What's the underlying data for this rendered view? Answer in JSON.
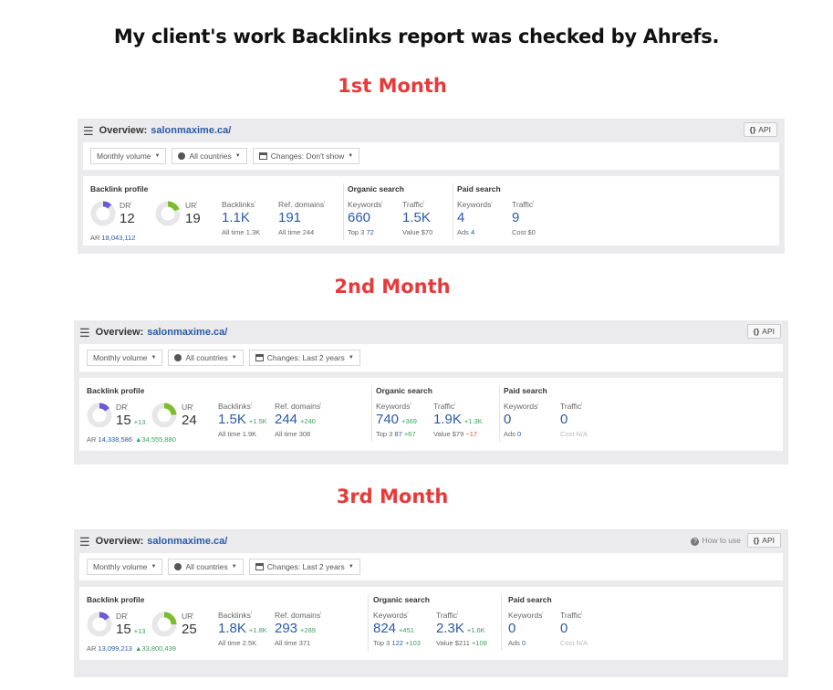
{
  "title": "My client's work Backlinks report was checked by Ahrefs.",
  "colors": {
    "month_title": "#e83a3a",
    "link_blue": "#2a5ba8",
    "positive": "#3aa35a",
    "negative": "#d9543b",
    "dr_color": "#6b5bd2",
    "ur_color": "#7cbd2e"
  },
  "labels": {
    "overview": "Overview:",
    "api": "API",
    "how_to_use": "How to use",
    "backlink_profile": "Backlink profile",
    "organic_search": "Organic search",
    "paid_search": "Paid search",
    "dr": "DR",
    "ur": "UR",
    "backlinks": "Backlinks",
    "ref_domains": "Ref. domains",
    "keywords": "Keywords",
    "traffic": "Traffic",
    "ar": "AR",
    "all_time": "All time",
    "top3": "Top 3",
    "value": "Value",
    "ads": "Ads",
    "cost": "Cost",
    "info": "i"
  },
  "icons": {
    "menu": "hamburger-menu-icon",
    "globe": "globe-icon",
    "calendar": "calendar-icon",
    "caret": "caret-down-icon",
    "api": "code-braces-icon",
    "help": "question-circle-icon"
  },
  "reports": [
    {
      "month": "1st Month",
      "domain": "salonmaxime.ca/",
      "show_how_to_use": false,
      "filters": {
        "volume": "Monthly volume",
        "countries": "All countries",
        "changes": "Changes: Don't show"
      },
      "dr": {
        "value": "12",
        "delta": "",
        "fraction": 0.12
      },
      "ur": {
        "value": "19",
        "delta": "",
        "fraction": 0.19
      },
      "ar": {
        "value": "18,043,112",
        "delta": ""
      },
      "backlinks": {
        "value": "1.1K",
        "delta": "",
        "all_time": "1.3K"
      },
      "ref_domains": {
        "value": "191",
        "delta": "",
        "all_time": "244"
      },
      "organic_keywords": {
        "value": "660",
        "delta": "",
        "top3": "72",
        "top3_delta": ""
      },
      "organic_traffic": {
        "value": "1.5K",
        "delta": "",
        "value_usd": "$70",
        "value_delta": ""
      },
      "paid_keywords": {
        "value": "4",
        "ads": "4"
      },
      "paid_traffic": {
        "value": "9",
        "cost": "$0"
      }
    },
    {
      "month": "2nd Month",
      "domain": "salonmaxime.ca/",
      "show_how_to_use": false,
      "filters": {
        "volume": "Monthly volume",
        "countries": "All countries",
        "changes": "Changes: Last 2 years"
      },
      "dr": {
        "value": "15",
        "delta": "+13",
        "fraction": 0.15
      },
      "ur": {
        "value": "24",
        "delta": "",
        "fraction": 0.24
      },
      "ar": {
        "value": "14,338,586",
        "delta": "▲34,555,880"
      },
      "backlinks": {
        "value": "1.5K",
        "delta": "+1.5K",
        "all_time": "1.9K"
      },
      "ref_domains": {
        "value": "244",
        "delta": "+240",
        "all_time": "308"
      },
      "organic_keywords": {
        "value": "740",
        "delta": "+369",
        "top3": "87",
        "top3_delta": "+67"
      },
      "organic_traffic": {
        "value": "1.9K",
        "delta": "+1.3K",
        "value_usd": "$79",
        "value_delta": "−17"
      },
      "paid_keywords": {
        "value": "0",
        "ads": "0"
      },
      "paid_traffic": {
        "value": "0",
        "cost": "N/A"
      }
    },
    {
      "month": "3rd Month",
      "domain": "salonmaxime.ca/",
      "show_how_to_use": true,
      "filters": {
        "volume": "Monthly volume",
        "countries": "All countries",
        "changes": "Changes: Last 2 years"
      },
      "dr": {
        "value": "15",
        "delta": "+13",
        "fraction": 0.15
      },
      "ur": {
        "value": "25",
        "delta": "",
        "fraction": 0.25
      },
      "ar": {
        "value": "13,099,213",
        "delta": "▲33,800,439"
      },
      "backlinks": {
        "value": "1.8K",
        "delta": "+1.8K",
        "all_time": "2.5K"
      },
      "ref_domains": {
        "value": "293",
        "delta": "+289",
        "all_time": "371"
      },
      "organic_keywords": {
        "value": "824",
        "delta": "+451",
        "top3": "122",
        "top3_delta": "+103"
      },
      "organic_traffic": {
        "value": "2.3K",
        "delta": "+1.6K",
        "value_usd": "$211",
        "value_delta": "+108"
      },
      "paid_keywords": {
        "value": "0",
        "ads": "0"
      },
      "paid_traffic": {
        "value": "0",
        "cost": "N/A"
      }
    }
  ]
}
